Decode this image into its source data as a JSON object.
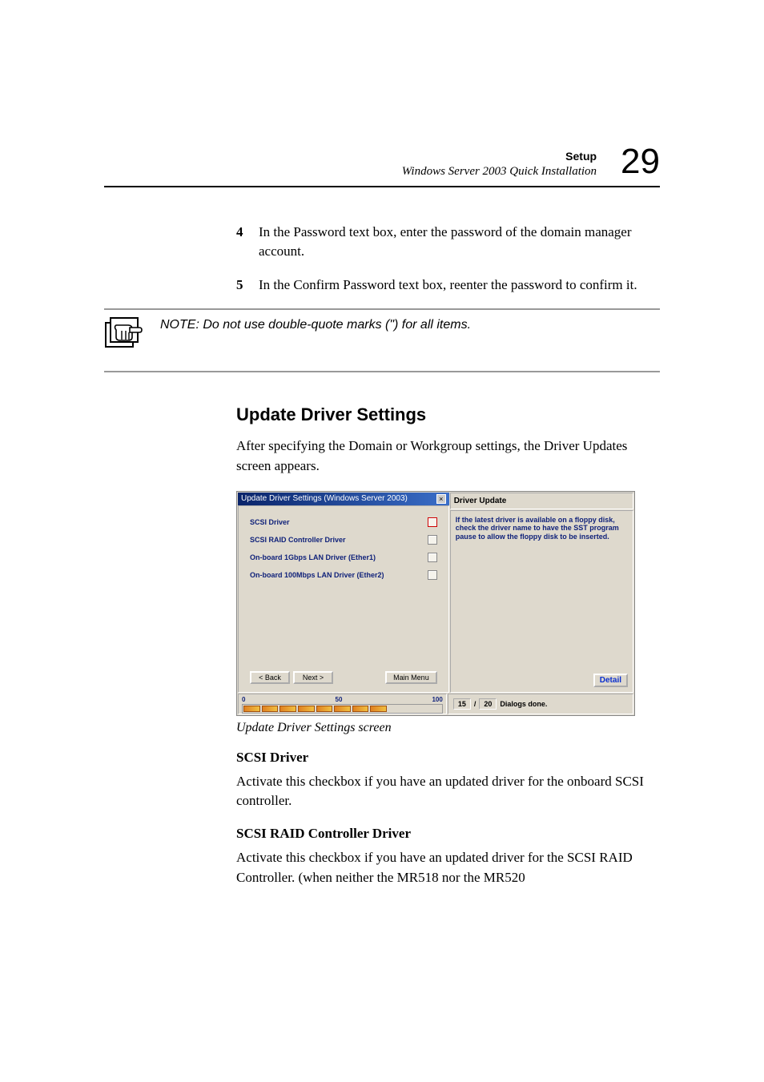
{
  "header": {
    "setup": "Setup",
    "subtitle": "Windows Server 2003 Quick Installation",
    "page_number": "29"
  },
  "steps": {
    "s4": {
      "num": "4",
      "text": "In the Password text box, enter the password of the domain manager account."
    },
    "s5": {
      "num": "5",
      "text": "In the Confirm Password text box, reenter the password to confirm it."
    }
  },
  "note": {
    "text": "NOTE: Do not use double-quote marks (\") for all items."
  },
  "section": {
    "heading": "Update Driver Settings",
    "intro": "After specifying the Domain or Workgroup settings, the Driver Updates screen appears.",
    "caption": "Update Driver Settings screen"
  },
  "screenshot": {
    "title": "Update Driver Settings (Windows Server 2003)",
    "close_x": "×",
    "drivers": {
      "d0": "SCSI Driver",
      "d1": "SCSI RAID Controller Driver",
      "d2": "On-board 1Gbps LAN Driver (Ether1)",
      "d3": "On-board 100Mbps LAN Driver (Ether2)"
    },
    "buttons": {
      "back": "< Back",
      "next": "Next >",
      "main": "Main Menu",
      "detail": "Detail"
    },
    "right": {
      "title": "Driver Update",
      "desc": "If the latest driver is available on a floppy disk, check the driver name to have the SST program pause to allow the floppy disk to be inserted."
    },
    "progress": {
      "p0": "0",
      "p50": "50",
      "p100": "100"
    },
    "status": {
      "cur": "15",
      "sep": "/",
      "tot": "20",
      "msg": "Dialogs done."
    }
  },
  "subsections": {
    "scsi": {
      "heading": "SCSI Driver",
      "body": "Activate this checkbox if you have an updated driver for the onboard SCSI controller."
    },
    "raid": {
      "heading": "SCSI RAID Controller Driver",
      "body": "Activate this checkbox if you have an updated driver for the SCSI RAID Controller. (when neither the MR518 nor the MR520"
    }
  }
}
